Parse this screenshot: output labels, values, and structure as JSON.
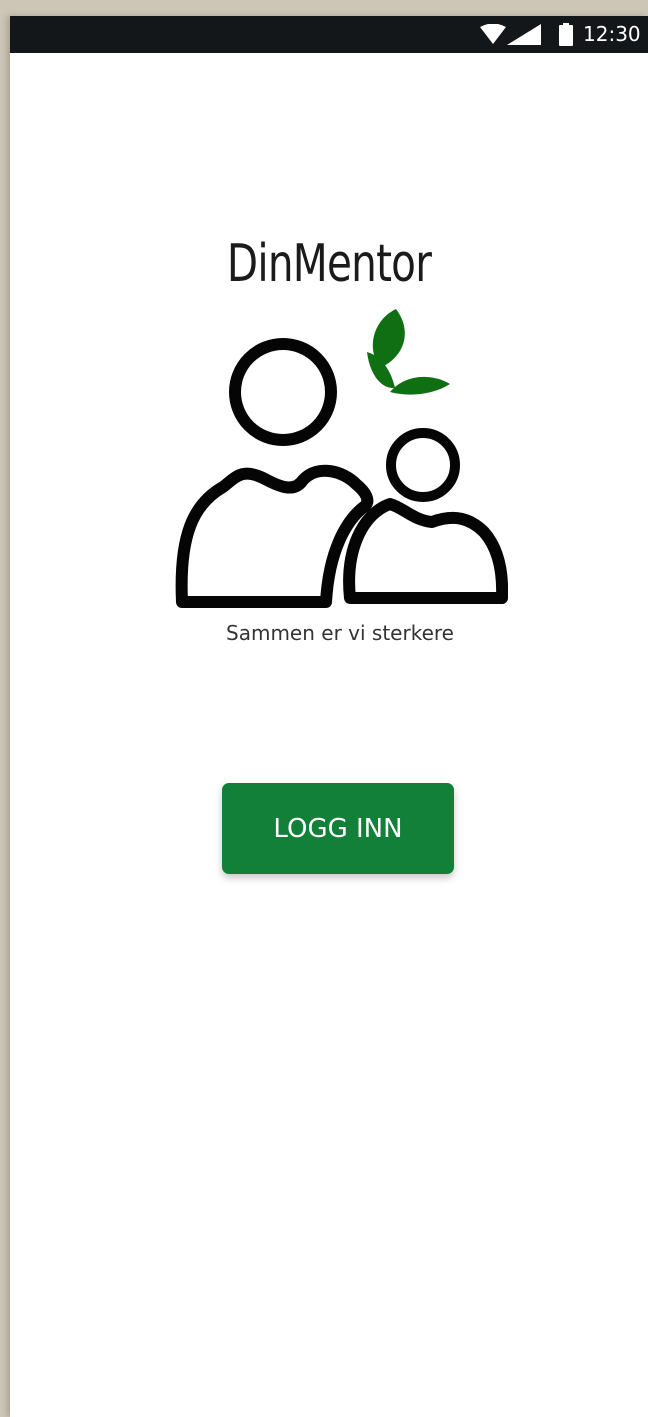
{
  "status_bar": {
    "time": "12:30",
    "icons": [
      "wifi-icon",
      "signal-icon",
      "battery-icon"
    ]
  },
  "app": {
    "title": "DinMentor",
    "tagline": "Sammen er vi sterkere",
    "logo_icon": "mentor-people-leaves-icon"
  },
  "login_button": {
    "label": "LOGG INN"
  },
  "colors": {
    "button": "#138039",
    "leaves": "#0f6f12",
    "status_bar": "#14171a",
    "background": "#ffffff"
  }
}
